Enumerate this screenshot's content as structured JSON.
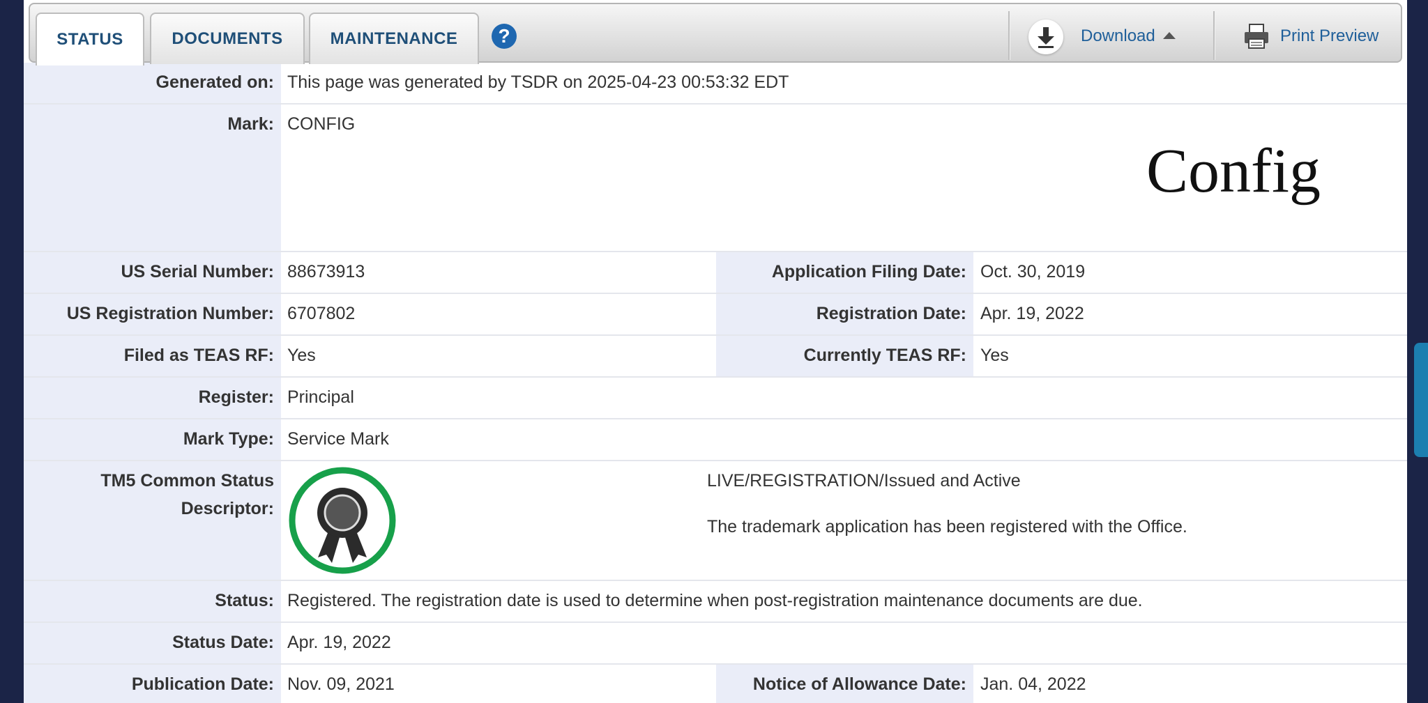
{
  "tabs": [
    {
      "label": "STATUS",
      "active": true
    },
    {
      "label": "DOCUMENTS",
      "active": false
    },
    {
      "label": "MAINTENANCE",
      "active": false
    }
  ],
  "help_icon": "question-mark-icon",
  "toolbar": {
    "download_label": "Download",
    "print_label": "Print Preview"
  },
  "generated_on": {
    "label": "Generated on:",
    "value": "This page was generated by TSDR on 2025-04-23 00:53:32 EDT"
  },
  "mark": {
    "label": "Mark:",
    "value": "CONFIG",
    "image_text": "Config"
  },
  "serial": {
    "label": "US Serial Number:",
    "value": "88673913"
  },
  "filing_date": {
    "label": "Application Filing Date:",
    "value": "Oct. 30, 2019"
  },
  "registration_number": {
    "label": "US Registration Number:",
    "value": "6707802"
  },
  "registration_date": {
    "label": "Registration Date:",
    "value": "Apr. 19, 2022"
  },
  "filed_teas": {
    "label": "Filed as TEAS RF:",
    "value": "Yes"
  },
  "current_teas": {
    "label": "Currently TEAS RF:",
    "value": "Yes"
  },
  "register": {
    "label": "Register:",
    "value": "Principal"
  },
  "mark_type": {
    "label": "Mark Type:",
    "value": "Service Mark"
  },
  "tm5": {
    "label_line1": "TM5 Common Status",
    "label_line2": "Descriptor:",
    "status_title": "LIVE/REGISTRATION/Issued and Active",
    "status_text": "The trademark application has been registered with the Office."
  },
  "status": {
    "label": "Status:",
    "value": "Registered. The registration date is used to determine when post-registration maintenance documents are due."
  },
  "status_date": {
    "label": "Status Date:",
    "value": "Apr. 19, 2022"
  },
  "publication_date": {
    "label": "Publication Date:",
    "value": "Nov. 09, 2021"
  },
  "allowance_date": {
    "label": "Notice of Allowance Date:",
    "value": "Jan. 04, 2022"
  },
  "colors": {
    "accent": "#1f4f78",
    "link": "#1f5f9a",
    "label_bg": "#eaedf8",
    "badge_green": "#17a04a"
  }
}
